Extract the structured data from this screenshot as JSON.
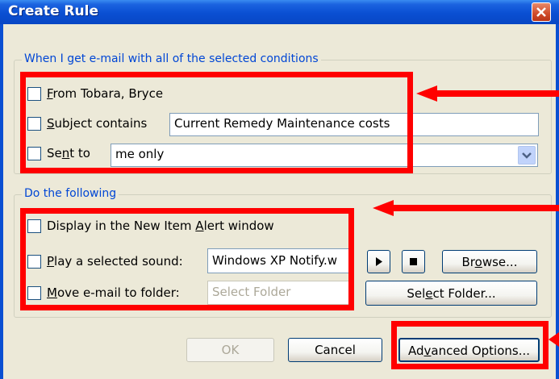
{
  "window": {
    "title": "Create Rule"
  },
  "conditions": {
    "legend": "When I get e-mail with all of the selected conditions",
    "from": {
      "pre": "",
      "key": "F",
      "post": "rom Tobara, Bryce"
    },
    "subject": {
      "pre": "",
      "key": "S",
      "post": "ubject contains",
      "value": "Current Remedy Maintenance costs"
    },
    "sentto": {
      "pre": "Se",
      "key": "n",
      "post": "t to",
      "value": "me only"
    }
  },
  "actions": {
    "legend": "Do the following",
    "display": {
      "pre": "Display in the New Item ",
      "key": "A",
      "post": "lert window"
    },
    "play": {
      "pre": "",
      "key": "P",
      "post": "lay a selected sound:",
      "value": "Windows XP Notify.w"
    },
    "move": {
      "pre": "",
      "key": "M",
      "post": "ove e-mail to folder:",
      "placeholder": "Select Folder"
    },
    "browse": {
      "pre": "Br",
      "key": "o",
      "post": "wse..."
    },
    "select_folder": {
      "pre": "Sel",
      "key": "e",
      "post": "ct Folder..."
    }
  },
  "buttons": {
    "ok": "OK",
    "cancel": "Cancel",
    "advanced": {
      "pre": "Ad",
      "key": "v",
      "post": "anced Options..."
    }
  },
  "colors": {
    "titlebar": "#0A4FD2",
    "legend": "#0046D5",
    "annotation": "#FF0000",
    "close": "#CF4A2A"
  }
}
